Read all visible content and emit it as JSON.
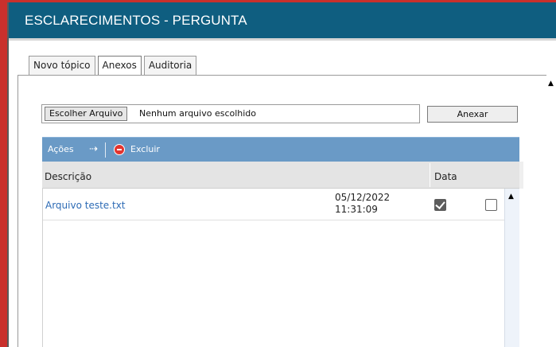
{
  "header": {
    "title": "ESCLARECIMENTOS - PERGUNTA"
  },
  "tabs": [
    {
      "label": "Novo tópico",
      "active": false
    },
    {
      "label": "Anexos",
      "active": true
    },
    {
      "label": "Auditoria",
      "active": false
    }
  ],
  "upload": {
    "choose_label": "Escolher Arquivo",
    "status": "Nenhum arquivo escolhido",
    "attach_label": "Anexar"
  },
  "toolbar": {
    "actions_label": "Ações",
    "actions_icon": "arrow-right-icon",
    "delete_label": "Excluir",
    "delete_icon": "minus-circle-icon"
  },
  "grid": {
    "columns": [
      "Descrição",
      "Data"
    ],
    "rows": [
      {
        "description": "Arquivo teste.txt",
        "date": "05/12/2022",
        "time": "11:31:09",
        "checked_a": true,
        "checked_b": false
      }
    ]
  },
  "colors": {
    "header_bg": "#0f5e80",
    "frame_accent": "#c9302c",
    "toolbar_bg": "#6a9ac6",
    "link": "#2d6bb5"
  }
}
